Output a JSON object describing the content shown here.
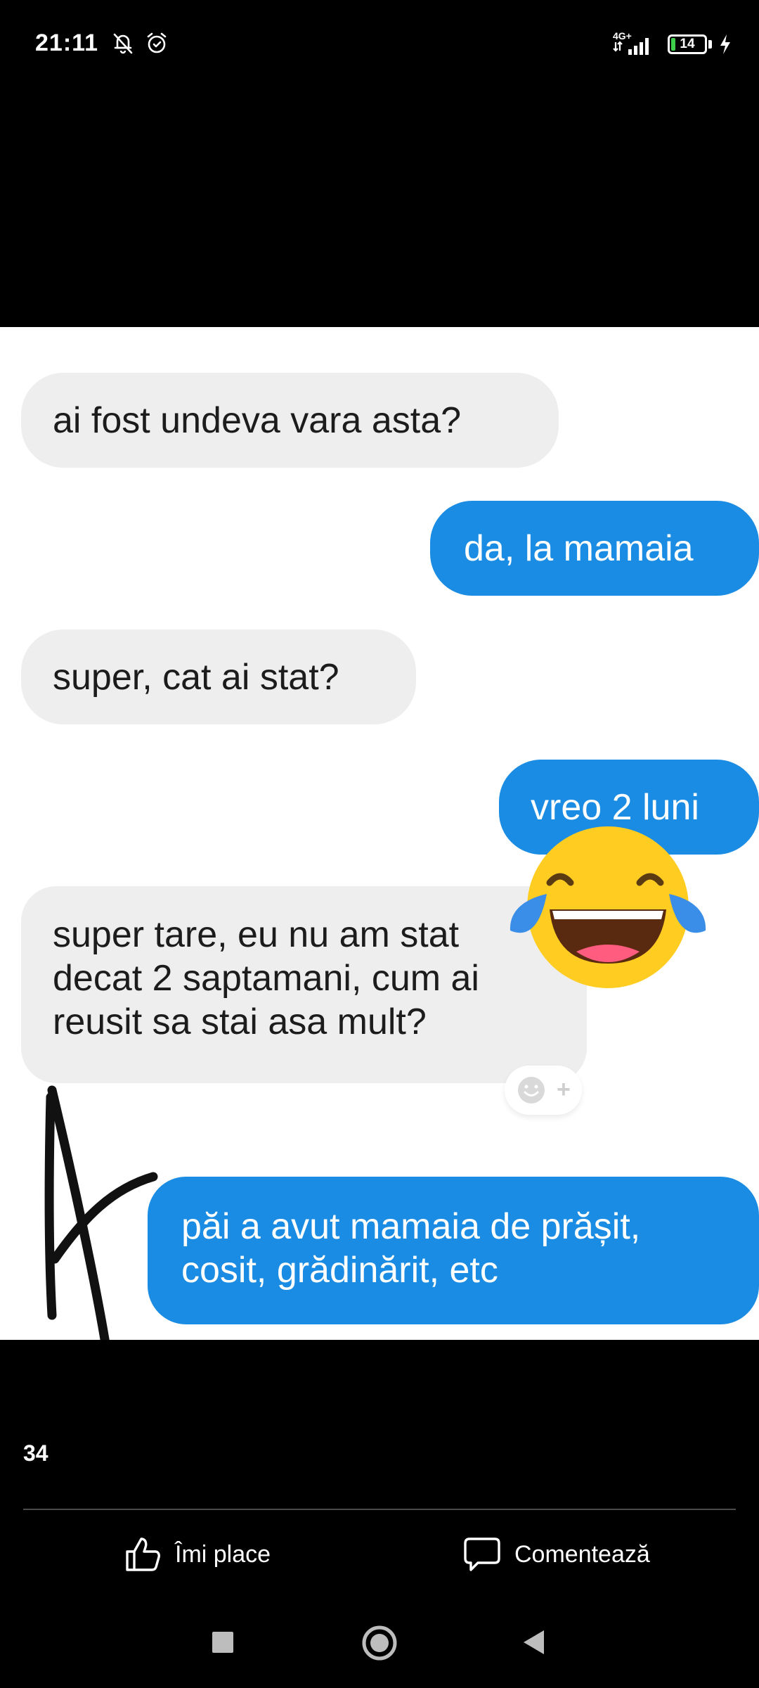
{
  "status_bar": {
    "time": "21:11",
    "network_label": "4G+",
    "battery_level": "14",
    "battery_fraction": 0.14,
    "icons": [
      "bell-off-icon",
      "alarm-icon",
      "signal-icon",
      "battery-icon",
      "charging-icon"
    ]
  },
  "chat": {
    "messages": [
      {
        "side": "incoming",
        "text": "ai fost undeva vara asta?"
      },
      {
        "side": "outgoing",
        "text": "da, la mamaia"
      },
      {
        "side": "incoming",
        "text": "super, cat ai stat?"
      },
      {
        "side": "outgoing",
        "text": "vreo 2 luni"
      },
      {
        "side": "incoming",
        "text": "super tare, eu nu am stat\ndecat 2 saptamani, cum ai\nreusit sa stai asa mult?"
      },
      {
        "side": "outgoing",
        "text": "păi a avut mamaia de prășit,\ncosit, grădinărit, etc"
      }
    ],
    "react_button": {
      "icon": "add-reaction-icon",
      "symbol": "+"
    },
    "sticker": "laughing-tears-emoji-icon",
    "scribble": "hand-drawn-letter-a"
  },
  "post": {
    "like_count": "34",
    "like_label": "Îmi place",
    "comment_label": "Comentează"
  },
  "nav": {
    "buttons": [
      "recents-icon",
      "home-icon",
      "back-icon"
    ]
  },
  "colors": {
    "incoming_bubble": "#eeeeee",
    "outgoing_bubble": "#1b8ce3",
    "background": "#000000",
    "image_background": "#ffffff",
    "battery_fill": "#3ecf4a",
    "emoji_face": "#ffcc22"
  }
}
